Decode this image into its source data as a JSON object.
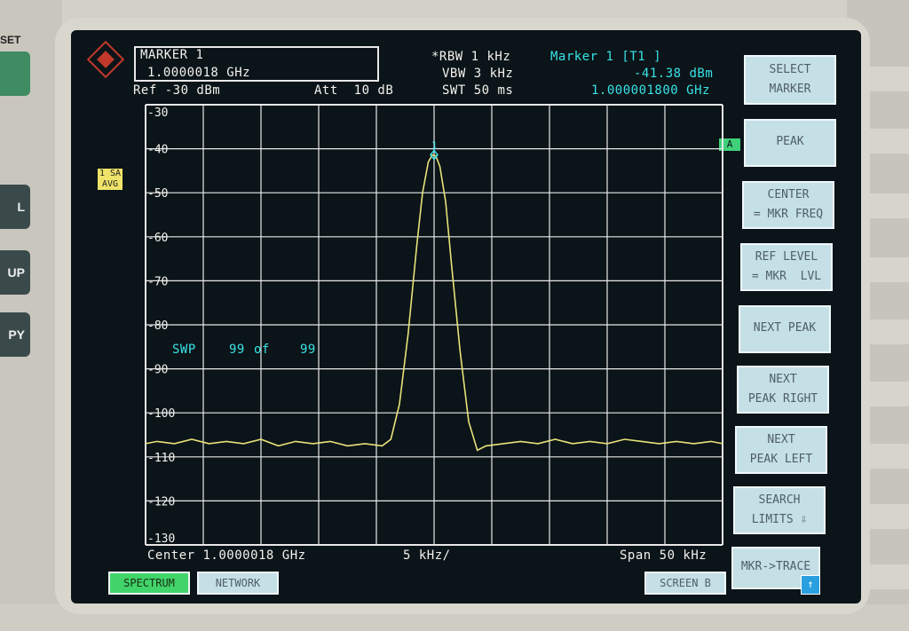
{
  "hardware": {
    "top_key_label": "SET",
    "side_keys": [
      "L",
      "UP",
      "PY"
    ]
  },
  "marker_box": {
    "title": "MARKER 1",
    "value": "1.0000018 GHz"
  },
  "header": {
    "ref": "Ref -30 dBm",
    "att": "Att  10 dB",
    "rbw": "*RBW 1 kHz",
    "vbw": "VBW 3 kHz",
    "swt": "SWT 50 ms",
    "marker_info": "Marker 1 [T1 ]",
    "marker_level": "-41.38 dBm",
    "marker_freq": "1.000001800 GHz"
  },
  "side_tag": [
    "1 SA",
    "AVG"
  ],
  "trace_label": "A",
  "sweep": {
    "label": "SWP",
    "count": "99",
    "of": "of",
    "total": "99"
  },
  "footer": {
    "center": "Center 1.0000018 GHz",
    "div": "5 kHz/",
    "span": "Span 50 kHz"
  },
  "softkeys": [
    {
      "id": "select-marker",
      "label": "SELECT\nMARKER"
    },
    {
      "id": "peak",
      "label": "PEAK"
    },
    {
      "id": "center-mkr-freq",
      "label": "CENTER\n= MKR FREQ"
    },
    {
      "id": "ref-level-mkr-lvl",
      "label": "REF LEVEL\n= MKR  LVL"
    },
    {
      "id": "next-peak",
      "label": "NEXT PEAK"
    },
    {
      "id": "next-peak-right",
      "label": "NEXT\nPEAK RIGHT"
    },
    {
      "id": "next-peak-left",
      "label": "NEXT\nPEAK LEFT"
    },
    {
      "id": "search-limits",
      "label": "SEARCH\nLIMITS ⇩"
    },
    {
      "id": "mkr-trace",
      "label": "MKR->TRACE"
    }
  ],
  "bottom_keys": {
    "spectrum": "SPECTRUM",
    "network": "NETWORK",
    "screen_b": "SCREEN B"
  },
  "colors": {
    "trace": "#e8e27a",
    "grid": "#e8e8e8",
    "accent_cyan": "#39e3e8",
    "softkey": "#c5dfe6",
    "active_green": "#41d46a"
  },
  "chart_data": {
    "type": "line",
    "xlabel": "",
    "ylabel": "",
    "ylim": [
      -130,
      -30
    ],
    "yticks": [
      "-30",
      "-40",
      "-50",
      "-60",
      "-70",
      "-80",
      "-90",
      "-100",
      "-110",
      "-120",
      "-130"
    ],
    "x_divisions": 10,
    "series": [
      {
        "x": [
          0,
          0.2,
          0.5,
          0.8,
          1.1,
          1.4,
          1.7,
          2.0,
          2.3,
          2.6,
          2.9,
          3.2,
          3.5,
          3.8,
          4.1,
          4.25,
          4.4,
          4.55,
          4.7,
          4.8,
          4.9,
          4.97,
          5.03,
          5.1,
          5.2,
          5.3,
          5.45,
          5.6,
          5.75,
          5.9,
          6.2,
          6.5,
          6.8,
          7.1,
          7.4,
          7.7,
          8.0,
          8.3,
          8.6,
          8.9,
          9.2,
          9.5,
          9.8,
          10
        ],
        "y": [
          -107,
          -106.5,
          -107,
          -106,
          -107,
          -106.5,
          -107,
          -106,
          -107.5,
          -106.5,
          -107,
          -106.5,
          -107.5,
          -107,
          -107.5,
          -106,
          -98,
          -82,
          -62,
          -50,
          -43,
          -41.4,
          -41.6,
          -44,
          -52,
          -66,
          -86,
          -102,
          -108.5,
          -107.5,
          -107,
          -106.5,
          -107,
          -106,
          -107,
          -106.5,
          -107,
          -106,
          -106.5,
          -107,
          -106.5,
          -107,
          -106.5,
          -107
        ]
      }
    ],
    "marker": {
      "label": "1",
      "x": 5.0,
      "y": -41.38
    }
  }
}
